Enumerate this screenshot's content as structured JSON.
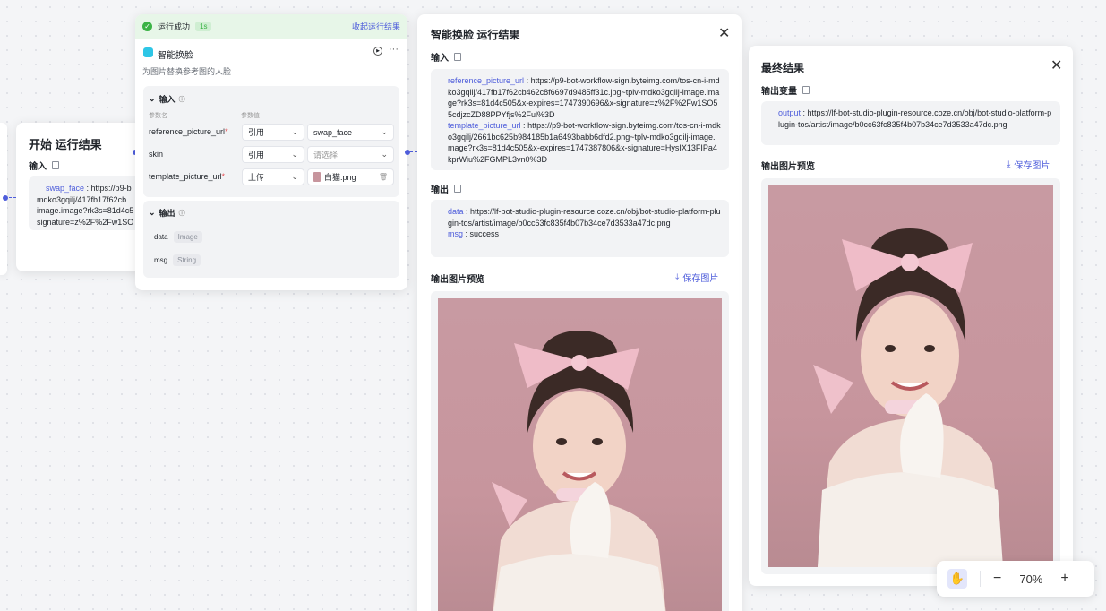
{
  "start_panel": {
    "title": "开始 运行结果",
    "input_label": "输入",
    "key": "swap_face",
    "lines": [
      "https://p9-b",
      "mdko3gqilj/417fb17f62cb",
      "image.image?rk3s=81d4c5",
      "signature=z%2F%2Fw1SO"
    ]
  },
  "node": {
    "status_text": "运行成功",
    "status_time": "1s",
    "collapse_link": "收起运行结果",
    "name": "智能换脸",
    "description": "为图片替换参考图的人脸",
    "input_section": "输入",
    "col_param": "参数名",
    "col_value": "参数值",
    "params": [
      {
        "name": "reference_picture_url",
        "type": "引用",
        "value": "swap_face",
        "required": "*"
      },
      {
        "name": "skin",
        "type": "引用",
        "value": "请选择",
        "required": ""
      },
      {
        "name": "template_picture_url",
        "type": "上传",
        "value": "白猫.png",
        "required": "*"
      }
    ],
    "output_section": "输出",
    "outputs": [
      {
        "name": "data",
        "type": "Image"
      },
      {
        "name": "msg",
        "type": "String"
      }
    ]
  },
  "result": {
    "title": "智能换脸 运行结果",
    "input_label": "输入",
    "inputs": [
      {
        "key": "reference_picture_url",
        "value": "https://p9-bot-workflow-sign.byteimg.com/tos-cn-i-mdko3gqilj/417fb17f62cb462c8f6697d9485ff31c.jpg~tplv-mdko3gqilj-image.image?rk3s=81d4c505&x-expires=1747390696&x-signature=z%2F%2Fw1SO55cdjzcZD88PPYfjs%2Ful%3D"
      },
      {
        "key": "template_picture_url",
        "value": "https://p9-bot-workflow-sign.byteimg.com/tos-cn-i-mdko3gqilj/2661bc625b984185b1a6493babb6dfd2.png~tplv-mdko3gqilj-image.image?rk3s=81d4c505&x-expires=1747387806&x-signature=HysIX13FIPa4kprWiu%2FGMPL3vn0%3D"
      }
    ],
    "output_label": "输出",
    "outputs": [
      {
        "key": "data",
        "value": "https://lf-bot-studio-plugin-resource.coze.cn/obj/bot-studio-platform-plugin-tos/artist/image/b0cc63fc835f4b07b34ce7d3533a47dc.png"
      },
      {
        "key": "msg",
        "value": "success"
      }
    ],
    "preview_label": "输出图片预览",
    "save_label": "保存图片"
  },
  "final": {
    "title": "最终结果",
    "var_label": "输出变量",
    "key": "output",
    "value": "https://lf-bot-studio-plugin-resource.coze.cn/obj/bot-studio-platform-plugin-tos/artist/image/b0cc63fc835f4b07b34ce7d3533a47dc.png",
    "preview_label": "输出图片预览",
    "save_label": "保存图片"
  },
  "zoom": {
    "value": "70%",
    "minus": "−",
    "plus": "+"
  },
  "colors": {
    "accent": "#4e5ddb",
    "success": "#3bb346",
    "photo_bg": "#c7959d"
  },
  "icons": [
    "check-circle-icon",
    "plugin-icon",
    "play-icon",
    "more-icon",
    "copy-icon",
    "close-icon",
    "download-icon",
    "hand-icon",
    "chevron-down-icon",
    "info-icon"
  ]
}
